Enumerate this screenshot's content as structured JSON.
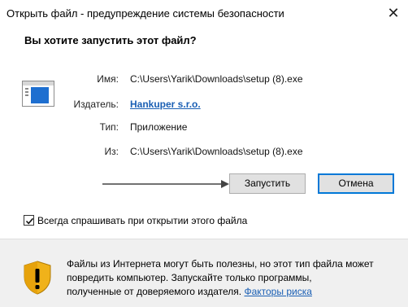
{
  "window": {
    "title": "Открыть файл - предупреждение системы безопасности",
    "close_icon": "close-icon"
  },
  "question": "Вы хотите запустить этот файл?",
  "details": {
    "name_label": "Имя:",
    "name_value": "C:\\Users\\Yarik\\Downloads\\setup (8).exe",
    "publisher_label": "Издатель:",
    "publisher_value": "Hankuper s.r.o.",
    "type_label": "Тип:",
    "type_value": "Приложение",
    "from_label": "Из:",
    "from_value": "C:\\Users\\Yarik\\Downloads\\setup (8).exe"
  },
  "buttons": {
    "run_label": "Запустить",
    "cancel_label": "Отмена"
  },
  "checkbox": {
    "label": "Всегда спрашивать при открытии этого файла",
    "checked": true
  },
  "warning": {
    "line1": "Файлы из Интернета могут быть полезны, но этот тип файла может",
    "line2": "повредить компьютер. Запускайте только программы,",
    "line3_prefix": "полученные от доверяемого издателя. ",
    "risk_link": "Факторы риска",
    "icon": "shield-warning-icon"
  },
  "colors": {
    "link": "#1a5fb4",
    "accent": "#0078d7",
    "footer_bg": "#f0f0f0"
  }
}
